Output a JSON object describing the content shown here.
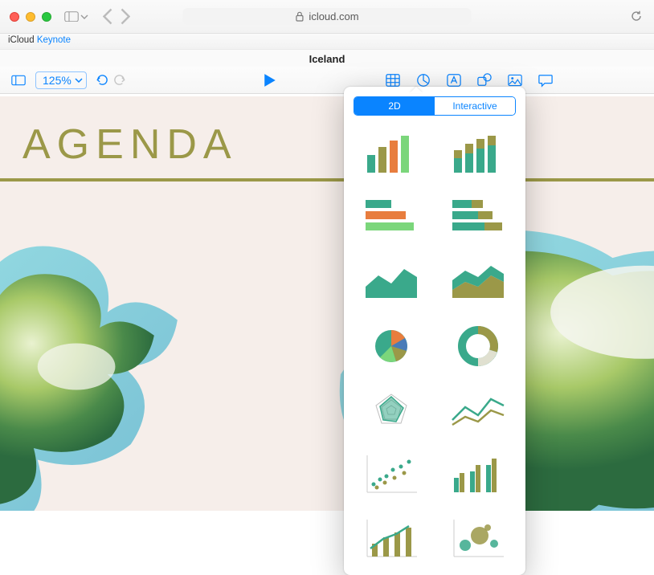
{
  "browser": {
    "url": "icloud.com"
  },
  "breadcrumb": {
    "service": "iCloud",
    "app": "Keynote"
  },
  "document": {
    "title": "Iceland"
  },
  "toolbar": {
    "zoom": "125%"
  },
  "slide": {
    "heading": "AGENDA"
  },
  "chart_popover": {
    "tabs": {
      "active": "2D",
      "inactive": "Interactive"
    },
    "types": [
      "bar-vertical",
      "bar-stacked",
      "bar-horizontal",
      "bar-horizontal-stacked",
      "area",
      "area-stacked",
      "pie",
      "donut",
      "radar",
      "line-multi",
      "scatter",
      "bar-grouped",
      "line-step",
      "bubble"
    ]
  }
}
